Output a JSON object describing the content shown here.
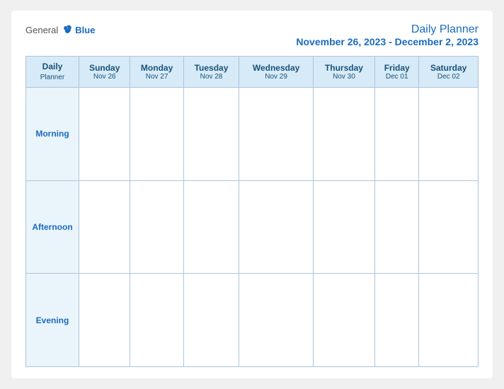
{
  "logo": {
    "general": "General",
    "blue": "Blue"
  },
  "title": {
    "main": "Daily Planner",
    "dates": "November 26, 2023 - December 2, 2023"
  },
  "header_col": {
    "line1": "Daily",
    "line2": "Planner"
  },
  "columns": [
    {
      "day": "Sunday",
      "date": "Nov 26"
    },
    {
      "day": "Monday",
      "date": "Nov 27"
    },
    {
      "day": "Tuesday",
      "date": "Nov 28"
    },
    {
      "day": "Wednesday",
      "date": "Nov 29"
    },
    {
      "day": "Thursday",
      "date": "Nov 30"
    },
    {
      "day": "Friday",
      "date": "Dec 01"
    },
    {
      "day": "Saturday",
      "date": "Dec 02"
    }
  ],
  "rows": [
    {
      "label": "Morning"
    },
    {
      "label": "Afternoon"
    },
    {
      "label": "Evening"
    }
  ]
}
